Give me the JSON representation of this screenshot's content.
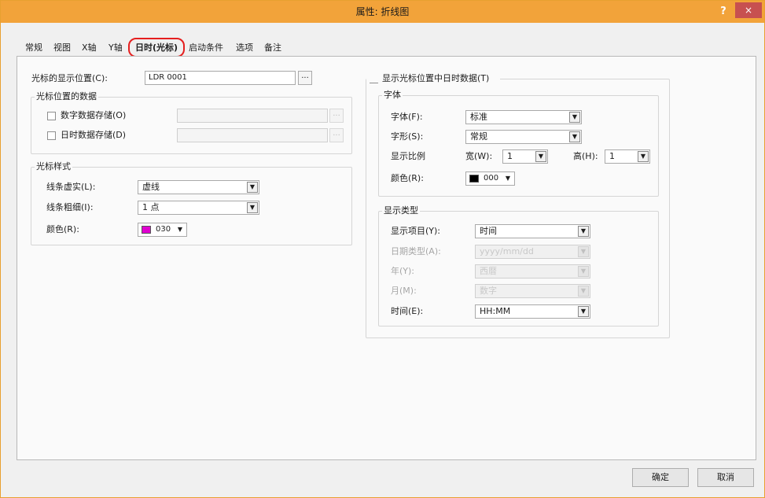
{
  "window": {
    "title": "属性: 折线图",
    "help": "?",
    "close": "×"
  },
  "tabs": [
    "常规",
    "视图",
    "X轴",
    "Y轴",
    "日时(光标)",
    "启动条件",
    "选项",
    "备注"
  ],
  "cursor_position": {
    "label": "光标的显示位置(C):",
    "value": "LDR 0001",
    "browse": "..."
  },
  "cursor_data": {
    "title": "光标位置的数据",
    "numeric_store": {
      "label": "数字数据存储(O)",
      "checked": false,
      "value": "",
      "browse": "..."
    },
    "datetime_store": {
      "label": "日时数据存储(D)",
      "checked": false,
      "value": "",
      "browse": "..."
    }
  },
  "cursor_style": {
    "title": "光标样式",
    "line_type": {
      "label": "线条虚实(L):",
      "value": "虚线"
    },
    "line_width": {
      "label": "线条粗细(I):",
      "value": "1 点"
    },
    "color": {
      "label": "颜色(R):",
      "code": "030",
      "swatch": "#e000d0"
    }
  },
  "show_datetime": {
    "label": "显示光标位置中日时数据(T)",
    "checked": true
  },
  "font": {
    "title": "字体",
    "family": {
      "label": "字体(F):",
      "value": "标准"
    },
    "style": {
      "label": "字形(S):",
      "value": "常规"
    },
    "scale": {
      "label": "显示比例",
      "width_label": "宽(W):",
      "width_value": "1",
      "height_label": "高(H):",
      "height_value": "1"
    },
    "color": {
      "label": "颜色(R):",
      "code": "000",
      "swatch": "#000000"
    }
  },
  "display_type": {
    "title": "显示类型",
    "item": {
      "label": "显示项目(Y):",
      "value": "时间"
    },
    "date_type": {
      "label": "日期类型(A):",
      "value": "yyyy/mm/dd"
    },
    "year": {
      "label": "年(Y):",
      "value": "西暦"
    },
    "month": {
      "label": "月(M):",
      "value": "数字"
    },
    "time": {
      "label": "时间(E):",
      "value": "HH:MM"
    }
  },
  "buttons": {
    "ok": "确定",
    "cancel": "取消"
  },
  "colors": {
    "accent": "#f2a33a",
    "close": "#c75050",
    "tab_highlight": "#e51f1f"
  }
}
